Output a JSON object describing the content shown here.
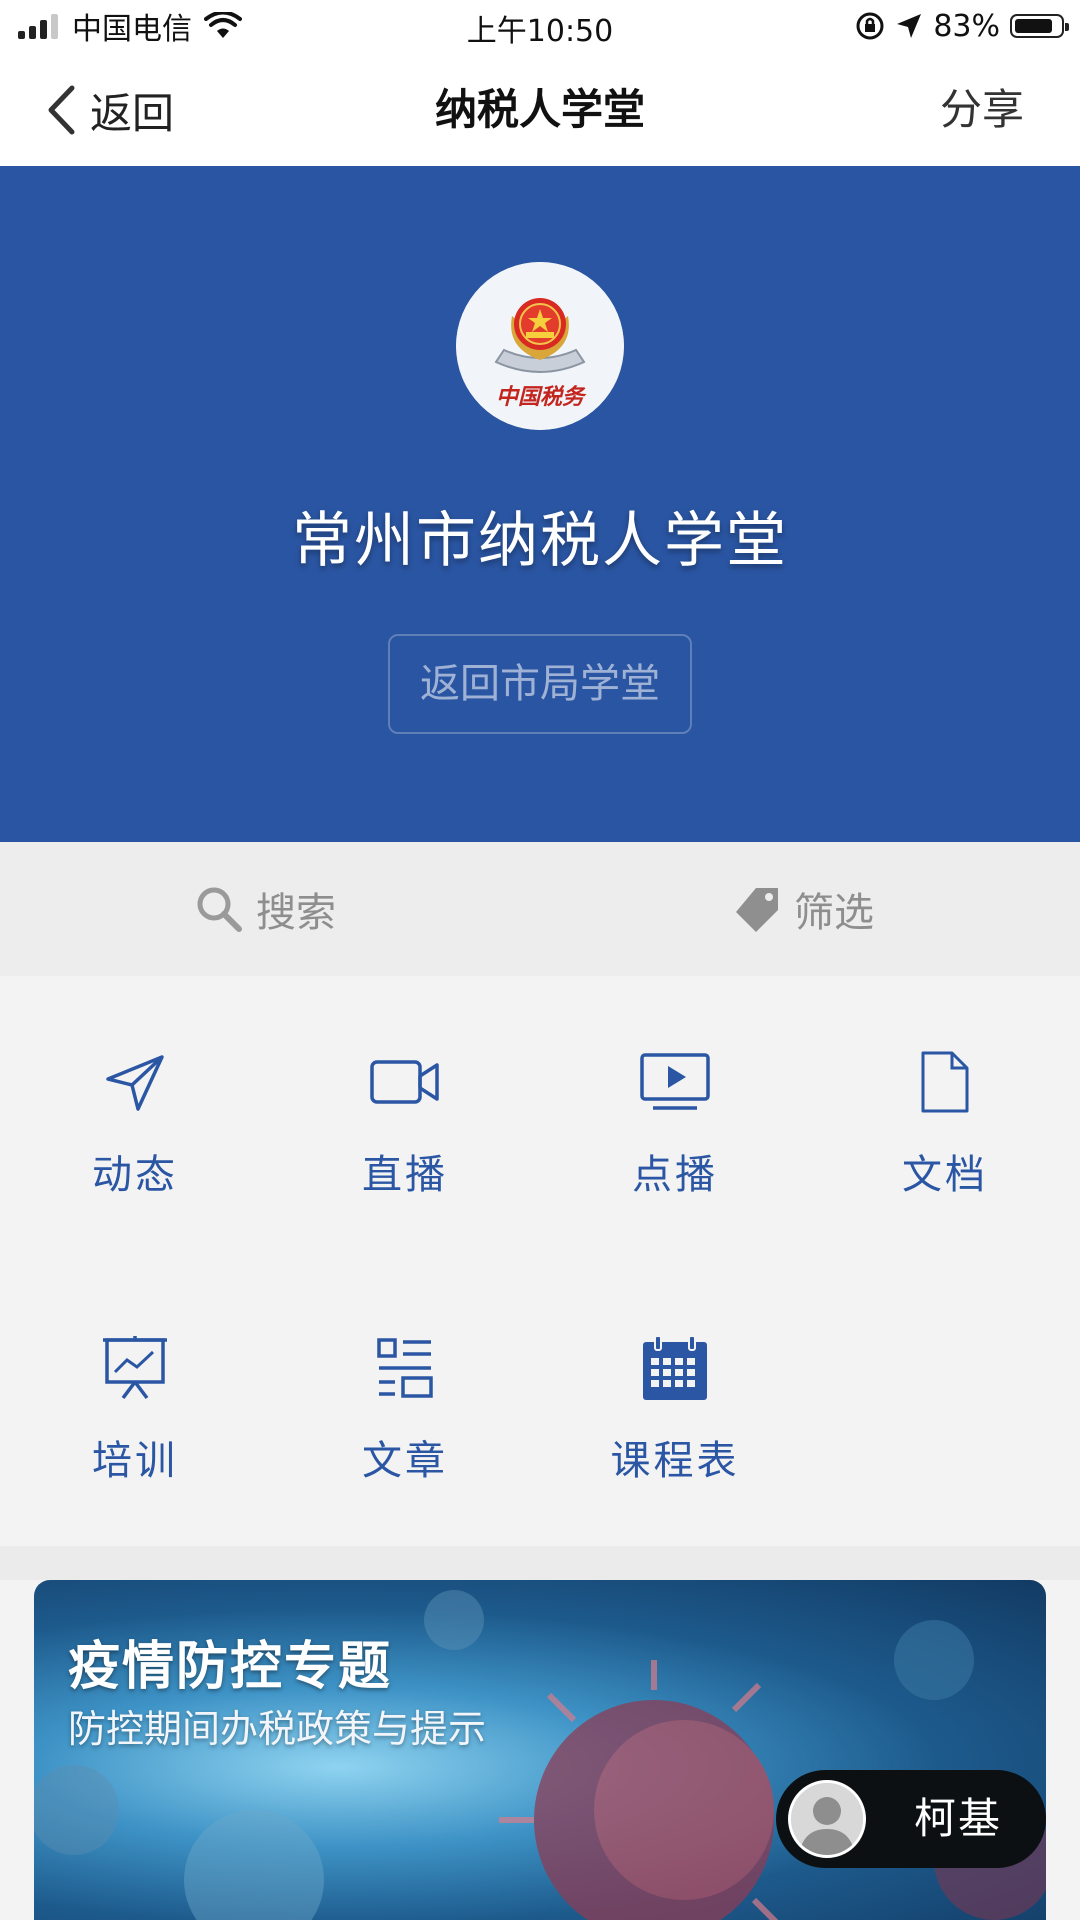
{
  "status_bar": {
    "carrier": "中国电信",
    "time": "上午10:50",
    "battery_percent": "83%",
    "battery_level": 0.83
  },
  "nav": {
    "back_label": "返回",
    "title": "纳税人学堂",
    "share_label": "分享"
  },
  "banner": {
    "logo_text": "中国税务",
    "title": "常州市纳税人学堂",
    "back_city_button": "返回市局学堂",
    "bg_color": "#2a55a2"
  },
  "toolbar": {
    "search_label": "搜索",
    "filter_label": "筛选"
  },
  "menu": {
    "items": [
      {
        "label": "动态",
        "icon": "send-icon"
      },
      {
        "label": "直播",
        "icon": "video-camera-icon"
      },
      {
        "label": "点播",
        "icon": "play-screen-icon"
      },
      {
        "label": "文档",
        "icon": "document-icon"
      },
      {
        "label": "培训",
        "icon": "presentation-board-icon"
      },
      {
        "label": "文章",
        "icon": "article-list-icon"
      },
      {
        "label": "课程表",
        "icon": "calendar-icon"
      }
    ],
    "accent_color": "#2b56a4"
  },
  "promo": {
    "title": "疫情防控专题",
    "subtitle": "防控期间办税政策与提示"
  },
  "floating_user": {
    "name": "柯基"
  }
}
